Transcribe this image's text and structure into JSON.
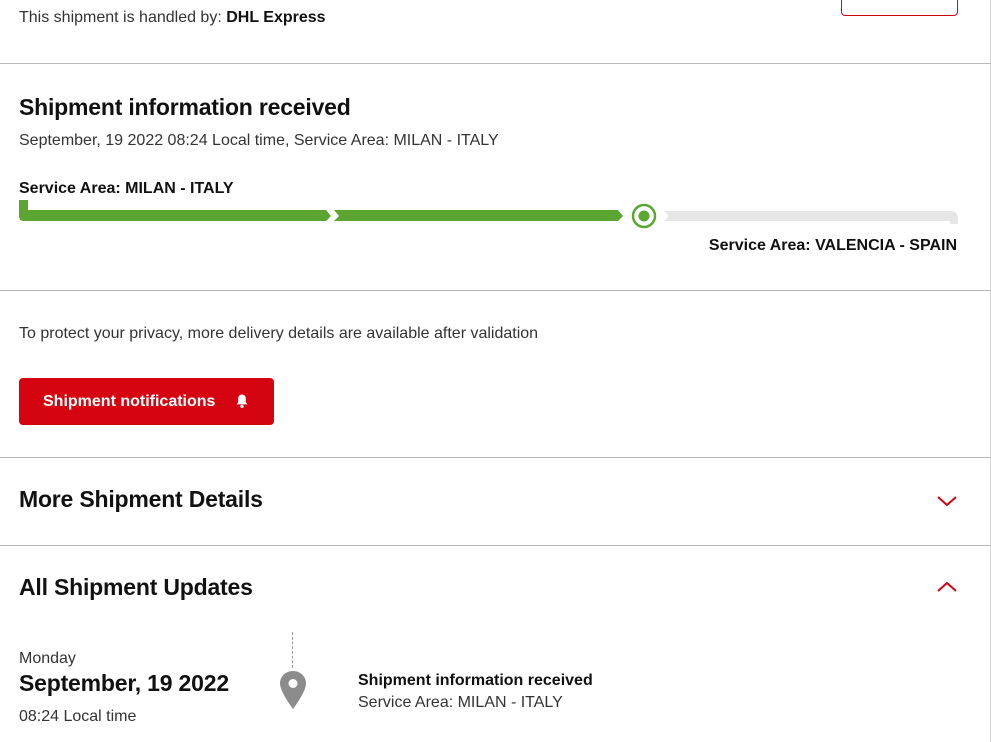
{
  "header": {
    "handled_prefix": "This shipment is handled by:",
    "carrier": "DHL Express"
  },
  "status": {
    "title": "Shipment information received",
    "subtitle": "September, 19 2022 08:24 Local time, Service Area: MILAN - ITALY",
    "origin_label": "Service Area: MILAN - ITALY",
    "destination_label": "Service Area: VALENCIA - SPAIN",
    "progress_fraction": 0.67,
    "colors": {
      "done": "#5aa631",
      "pending": "#e6e6e6"
    }
  },
  "privacy": {
    "text": "To protect your privacy, more delivery details are available after validation",
    "notify_button": "Shipment notifications",
    "notify_icon": "bell-icon",
    "button_color": "#d40511"
  },
  "more_details": {
    "heading": "More Shipment Details",
    "icon": "chevron-down-icon"
  },
  "updates": {
    "heading": "All Shipment Updates",
    "icon": "chevron-up-icon",
    "items": [
      {
        "day": "Monday",
        "date": "September, 19 2022",
        "time": "08:24 Local time",
        "icon": "location-pin-icon",
        "title": "Shipment information received",
        "location": "Service Area: MILAN - ITALY"
      }
    ]
  }
}
